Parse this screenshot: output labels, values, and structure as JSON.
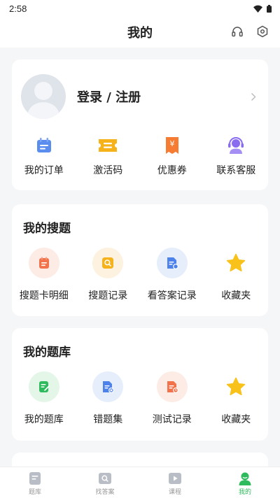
{
  "status_bar": {
    "time": "2:58"
  },
  "header": {
    "title": "我的",
    "headset_icon": "headset-icon",
    "settings_icon": "gear-icon"
  },
  "user": {
    "login_text": "登录 / 注册"
  },
  "quick_actions": [
    {
      "label": "我的订单",
      "icon": "order-icon",
      "color": "#5b8def"
    },
    {
      "label": "激活码",
      "icon": "activation-code-icon",
      "color": "#f6b21b"
    },
    {
      "label": "优惠券",
      "icon": "coupon-icon",
      "color": "#f57c32"
    },
    {
      "label": "联系客服",
      "icon": "customer-service-icon",
      "color": "#8a6cf0"
    }
  ],
  "my_search": {
    "title": "我的搜题",
    "items": [
      {
        "label": "搜题卡明细",
        "icon": "search-card-icon",
        "bg": "#fdebe5",
        "fg": "#f2724b"
      },
      {
        "label": "搜题记录",
        "icon": "search-record-icon",
        "bg": "#fdf1e0",
        "fg": "#f6b21b"
      },
      {
        "label": "看答案记录",
        "icon": "answer-record-icon",
        "bg": "#e6eefb",
        "fg": "#4c82ea"
      },
      {
        "label": "收藏夹",
        "icon": "star-icon",
        "bg": "#ffffff",
        "fg": "#f8c21a"
      }
    ]
  },
  "my_bank": {
    "title": "我的题库",
    "items": [
      {
        "label": "我的题库",
        "icon": "question-bank-icon",
        "bg": "#e3f6e8",
        "fg": "#2dbb5d"
      },
      {
        "label": "错题集",
        "icon": "wrong-questions-icon",
        "bg": "#e6eefb",
        "fg": "#4c82ea"
      },
      {
        "label": "测试记录",
        "icon": "test-record-icon",
        "bg": "#fdebe5",
        "fg": "#f2724b"
      },
      {
        "label": "收藏夹",
        "icon": "star-icon",
        "bg": "#ffffff",
        "fg": "#f8c21a"
      }
    ]
  },
  "tabs": [
    {
      "label": "题库",
      "icon": "question-bank-tab-icon",
      "active": false
    },
    {
      "label": "找答案",
      "icon": "find-answer-tab-icon",
      "active": false
    },
    {
      "label": "课程",
      "icon": "course-tab-icon",
      "active": false
    },
    {
      "label": "我的",
      "icon": "profile-tab-icon",
      "active": true
    }
  ],
  "colors": {
    "accent": "#2dbb5d",
    "background": "#f5f6f7"
  }
}
